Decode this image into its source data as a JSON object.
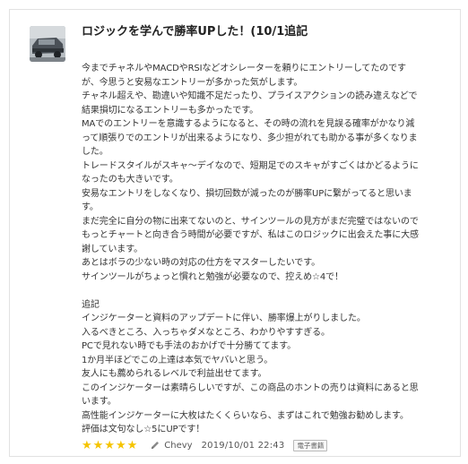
{
  "review": {
    "title": "ロジックを学んで勝率UPした！(10/1追記",
    "avatar_alt": "avatar-car-photo",
    "body_lines": [
      "今までチャネルやMACDやRSIなどオシレーターを頼りにエントリーしてたのです",
      "が、今思うと安易なエントリーが多かった気がします。",
      "チャネル超えや、勘違いや知識不足だったり、プライスアクションの読み違えなどで",
      "結果損切になるエントリーも多かったです。",
      "MAでのエントリーを意識するようになると、その時の流れを見誤る確率がかなり減",
      "って順張りでのエントリが出来るようになり、多少担がれても助かる事が多くなりま",
      "した。",
      "トレードスタイルがスキャ～デイなので、短期足でのスキャがすごくはかどるように",
      "なったのも大きいです。",
      "安易なエントリをしなくなり、損切回数が減ったのが勝率UPに繋がってると思いま",
      "す。",
      "まだ完全に自分の物に出来てないのと、サインツールの見方がまだ完璧ではないので",
      "もっとチャートと向き合う時間が必要ですが、私はこのロジックに出会えた事に大感",
      "謝しています。",
      "あとはボラの少ない時の対応の仕方をマスターしたいです。",
      "サインツールがちょっと慣れと勉強が必要なので、控えめ☆4で！",
      "",
      "追記",
      "インジケーターと資料のアップデートに伴い、勝率爆上がりしました。",
      "入るべきところ、入っちゃダメなところ、わかりやすすぎる。",
      "PCで見れない時でも手法のおかげで十分勝ててます。",
      "1か月半ほどでこの上達は本気でヤバいと思う。",
      "友人にも薦められるレベルで利益出せてます。",
      "このインジケーターは素晴らしいですが、この商品のホントの売りは資料にあると思",
      "います。",
      "高性能インジケーターに大枚はたくくらいなら、まずはこれで勉強お勧めします。",
      "評価は文句なし☆5にUPです！"
    ],
    "rating": 5,
    "stars": [
      "★",
      "★",
      "★",
      "★",
      "★"
    ],
    "reviewer": "Chevy",
    "date": "2019/10/01 22:43",
    "badge": "電子書籍",
    "colors": {
      "star": "#f5c400",
      "border": "#e2e2e2"
    },
    "icons": {
      "reviewer": "pen-icon",
      "rating": "star-icon"
    }
  }
}
